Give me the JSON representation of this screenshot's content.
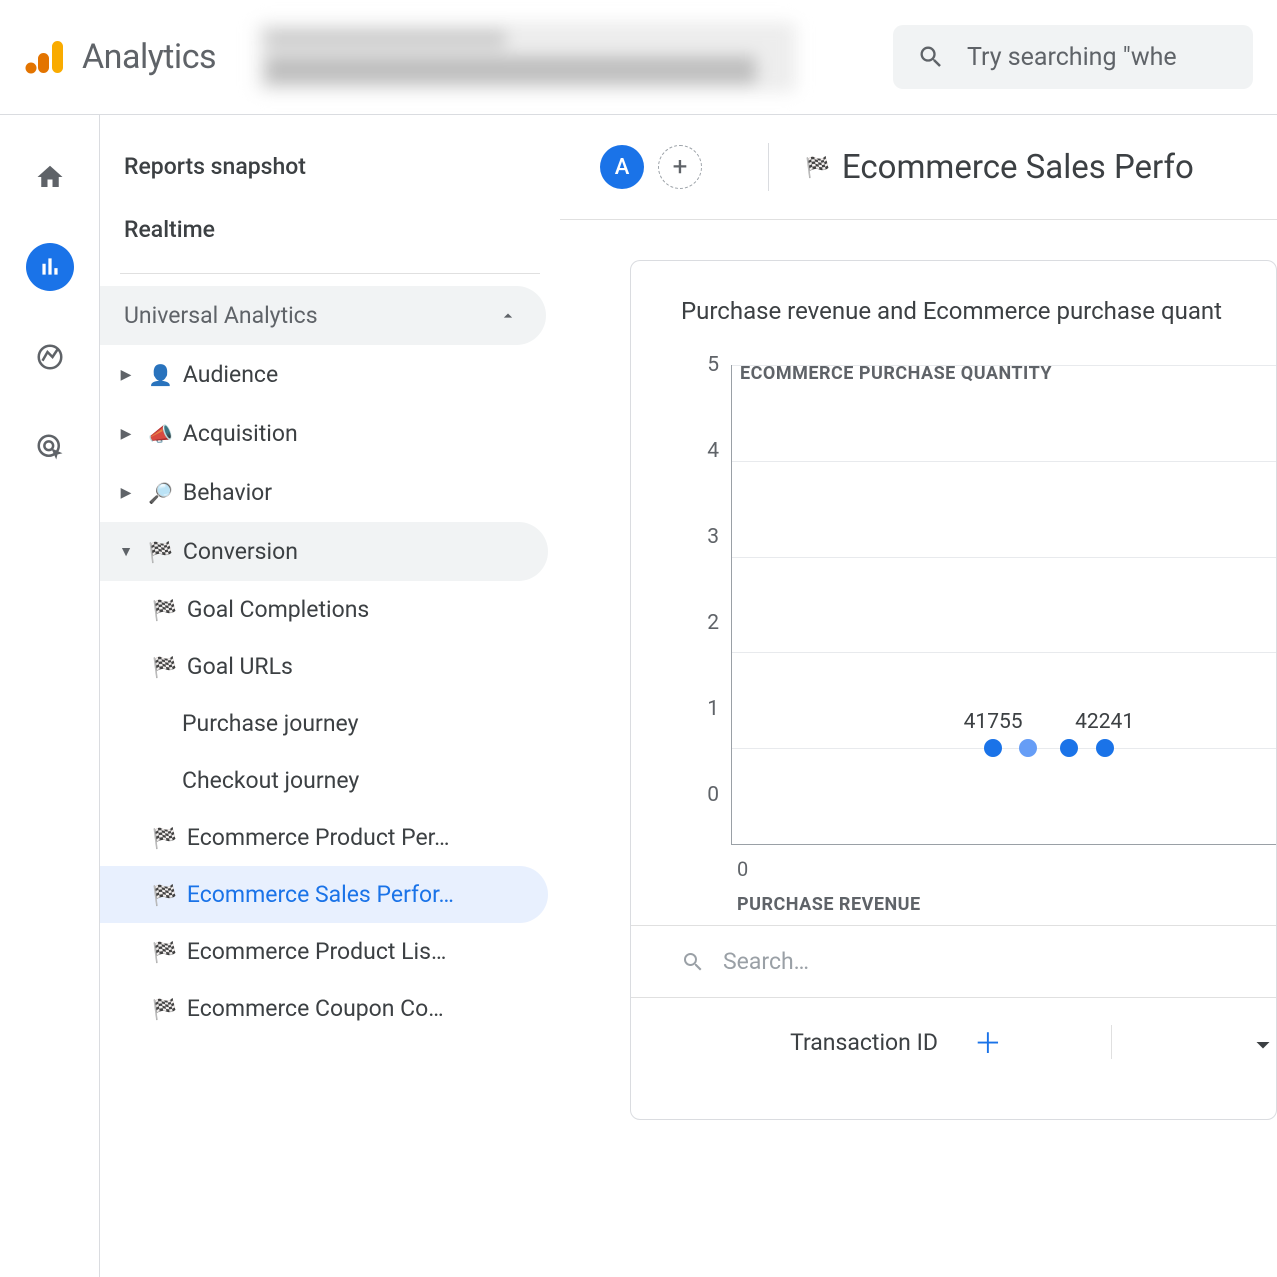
{
  "header": {
    "brand": "Analytics",
    "search_placeholder": "Try searching \"whe"
  },
  "rail": {
    "items": [
      "home-icon",
      "reports-icon",
      "explore-icon",
      "advertising-icon"
    ],
    "active_index": 1
  },
  "sidenav": {
    "top_items": [
      "Reports snapshot",
      "Realtime"
    ],
    "section_label": "Universal Analytics",
    "groups": [
      {
        "icon": "👤",
        "label": "Audience",
        "expanded": false
      },
      {
        "icon": "📣",
        "label": "Acquisition",
        "expanded": false
      },
      {
        "icon": "🔎",
        "label": "Behavior",
        "expanded": false
      },
      {
        "icon": "🏁",
        "label": "Conversion",
        "expanded": true
      }
    ],
    "sub_items": [
      {
        "icon": "🏁",
        "label": "Goal Completions"
      },
      {
        "icon": "🏁",
        "label": "Goal URLs"
      },
      {
        "icon": "",
        "label": "Purchase journey"
      },
      {
        "icon": "",
        "label": "Checkout journey"
      },
      {
        "icon": "🏁",
        "label": "Ecommerce Product Per…"
      },
      {
        "icon": "🏁",
        "label": "Ecommerce Sales Perfor…"
      },
      {
        "icon": "🏁",
        "label": "Ecommerce Product Lis…"
      },
      {
        "icon": "🏁",
        "label": "Ecommerce Coupon Co…"
      }
    ],
    "selected_sub_index": 5
  },
  "report": {
    "avatar_letter": "A",
    "title_icon": "🏁",
    "title": "Ecommerce Sales Perfo",
    "card_title": "Purchase revenue and Ecommerce purchase quant",
    "table": {
      "search_placeholder": "Search…",
      "col1_label": "Transaction ID"
    }
  },
  "chart_data": {
    "type": "scatter",
    "xlabel": "PURCHASE REVENUE",
    "ylabel_inline": "ECOMMERCE PURCHASE QUANTITY",
    "ylim": [
      0,
      5
    ],
    "yticks": [
      0,
      1,
      2,
      3,
      4,
      5
    ],
    "series": [
      {
        "name": "points",
        "points": [
          {
            "x_rel": 0.48,
            "y": 1,
            "label": "41755",
            "color": "#1a73e8"
          },
          {
            "x_rel": 0.545,
            "y": 1,
            "label": "",
            "color": "#669df6"
          },
          {
            "x_rel": 0.62,
            "y": 1,
            "label": "",
            "color": "#1a73e8"
          },
          {
            "x_rel": 0.685,
            "y": 1,
            "label": "42241",
            "color": "#1a73e8"
          }
        ]
      }
    ]
  }
}
